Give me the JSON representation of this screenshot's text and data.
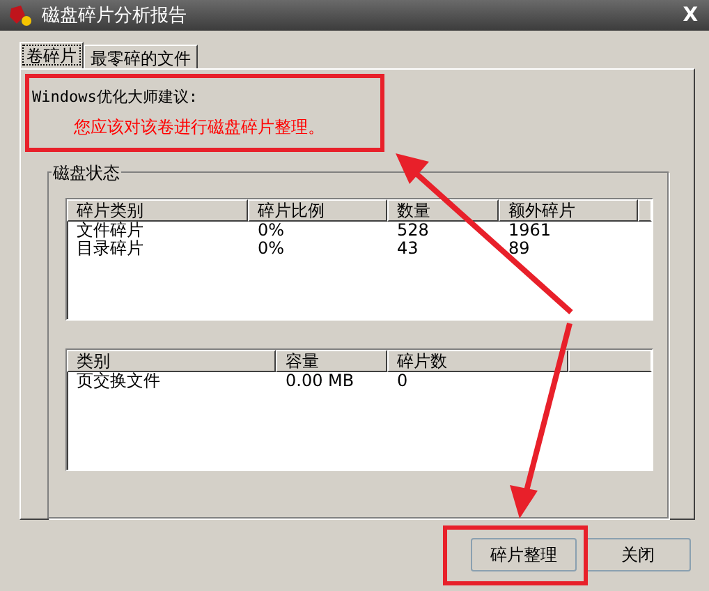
{
  "window": {
    "title": "磁盘碎片分析报告",
    "close": "X"
  },
  "tabs": [
    {
      "label": "卷碎片",
      "selected": true
    },
    {
      "label": "最零碎的文件",
      "selected": false
    }
  ],
  "advice": {
    "heading": "Windows优化大师建议:",
    "message": "您应该对该卷进行磁盘碎片整理。"
  },
  "group": {
    "title": "磁盘状态"
  },
  "tables": [
    {
      "columns": [
        "碎片类别",
        "碎片比例",
        "数量",
        "额外碎片"
      ],
      "rows": [
        [
          "文件碎片",
          "0%",
          "528",
          "1961"
        ],
        [
          "目录碎片",
          "0%",
          "43",
          "89"
        ]
      ]
    },
    {
      "columns": [
        "类别",
        "容量",
        "碎片数"
      ],
      "rows": [
        [
          "页交换文件",
          "0.00 MB",
          "0"
        ]
      ]
    }
  ],
  "buttons": [
    "碎片整理",
    "关闭"
  ]
}
